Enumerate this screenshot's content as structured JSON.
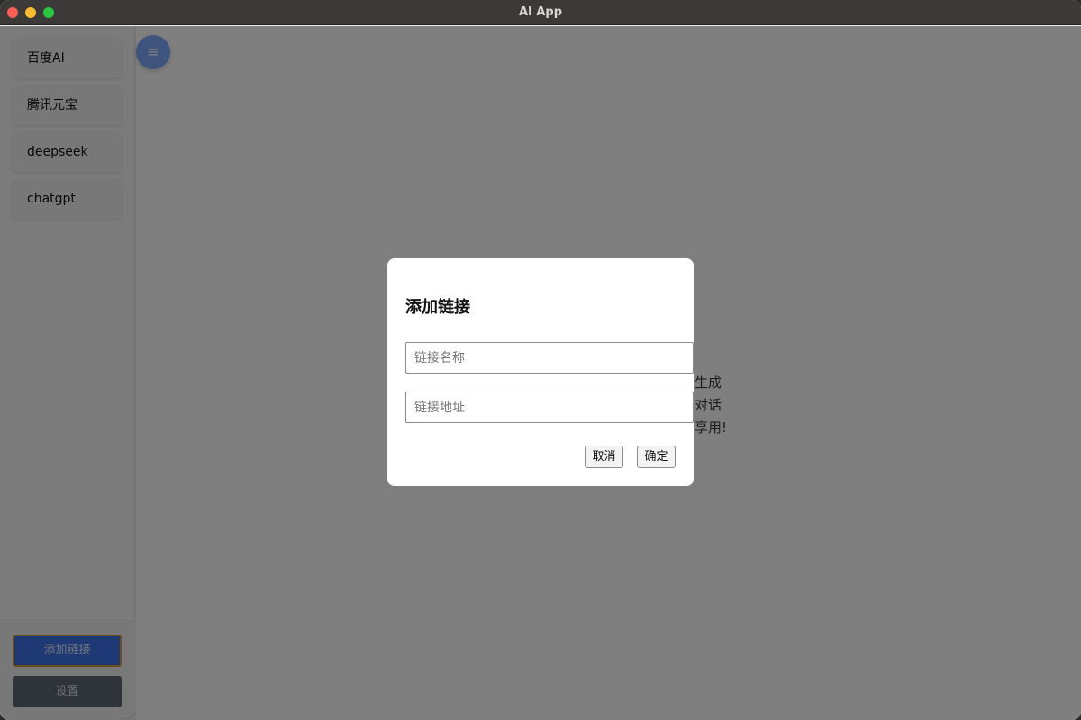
{
  "window": {
    "title": "AI App"
  },
  "sidebar": {
    "items": [
      {
        "label": "百度AI"
      },
      {
        "label": "腾讯元宝"
      },
      {
        "label": "deepseek"
      },
      {
        "label": "chatgpt"
      }
    ],
    "add_link_label": "添加链接",
    "settings_label": "设置"
  },
  "main": {
    "menu_icon": "≡",
    "welcome_lines": [
      "生成",
      "对话",
      "享用!"
    ]
  },
  "dialog": {
    "title": "添加链接",
    "name_placeholder": "链接名称",
    "url_placeholder": "链接地址",
    "cancel_label": "取消",
    "confirm_label": "确定"
  },
  "colors": {
    "accent": "#3f73ea",
    "settings_button": "#5d6872",
    "fab": "#7fa6ff"
  }
}
